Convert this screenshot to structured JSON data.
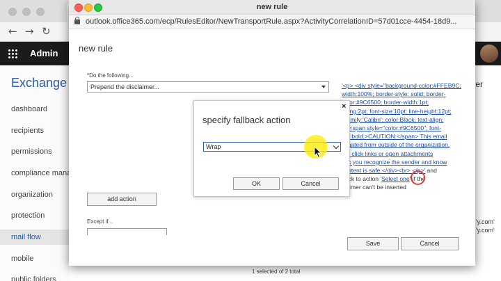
{
  "background": {
    "admin_label": "Admin",
    "title": "Exchange a",
    "nav": [
      "dashboard",
      "recipients",
      "permissions",
      "compliance mana",
      "organization",
      "protection",
      "mail flow",
      "mobile",
      "public folders"
    ],
    "selected_nav": "mail flow",
    "right_heading": "ter",
    "right_com_1": "'y.com'",
    "right_com_2": "'y.com'",
    "status": "1 selected of 2 total"
  },
  "popup": {
    "window_title": "new rule",
    "url": "outlook.office365.com/ecp/RulesEditor/NewTransportRule.aspx?ActivityCorrelationID=57d01cce-4454-18d9...",
    "heading": "new rule",
    "do_label": "*Do the following...",
    "do_value": "Prepend the disclaimer...",
    "add_action_label": "add action",
    "except_label": "Except if...",
    "disclaimer_lines": [
      "'<p> <div style=\"background-color:#FFEB9C;",
      "width:100%; border-style: solid; border-",
      "color:#9C6500; border-width:1pt;",
      "dding:2pt; font-size:10pt; line-height:12pt;",
      "t-family:'Calibri'; color:Black; text-align:",
      "\"> <span style=\"color:#9C6500\"; font-",
      "ght:bold;>CAUTION:</span> This email",
      "iginated from outside of the organization.",
      "not click links or open attachments",
      "ess you recognize the sender and know",
      "content is safe.</div><br> </p>'"
    ],
    "disclaimer_and": " and",
    "fallback_prefix": "back to action '",
    "fallback_link": "Select one",
    "fallback_suffix": "' if the",
    "fallback_end": "claimer can't be inserted",
    "save_label": "Save",
    "cancel_label": "Cancel"
  },
  "dialog": {
    "title": "specify fallback action",
    "close_glyph": "×",
    "selected_option": "Wrap",
    "ok_label": "OK",
    "cancel_label": "Cancel"
  },
  "colors": {
    "link": "#1a4ea3",
    "selected_border": "#2f5fb8",
    "highlight": "#ffeb00"
  }
}
